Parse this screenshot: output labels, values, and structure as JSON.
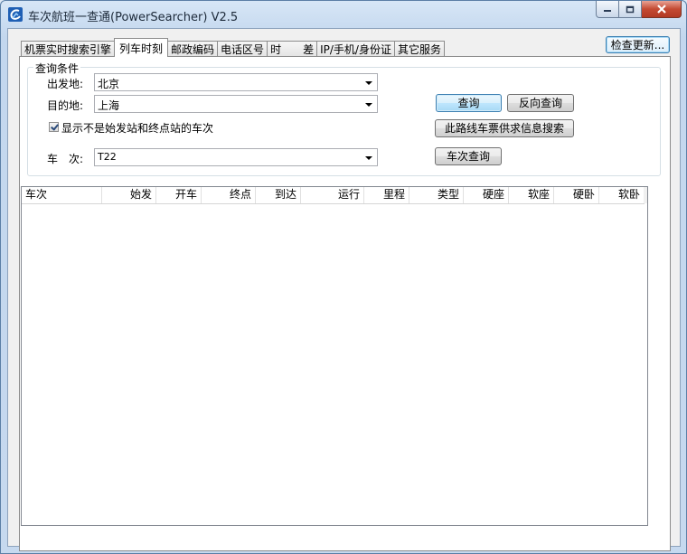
{
  "window": {
    "title": "车次航班一查通(PowerSearcher) V2.5"
  },
  "tabs": [
    {
      "label": "机票实时搜索引擎",
      "active": false
    },
    {
      "label": "列车时刻",
      "active": true
    },
    {
      "label": "邮政编码",
      "active": false
    },
    {
      "label": "电话区号",
      "active": false
    },
    {
      "label": "时　　差",
      "active": false
    },
    {
      "label": "IP/手机/身份证",
      "active": false
    },
    {
      "label": "其它服务",
      "active": false
    }
  ],
  "check_update_label": "检查更新...",
  "query": {
    "group_title": "查询条件",
    "departure_label": "出发地:",
    "departure_value": "北京",
    "destination_label": "目的地:",
    "destination_value": "上海",
    "show_nonterminal_label": "显示不是始发站和终点站的车次",
    "show_nonterminal_checked": true,
    "train_label": "车　次:",
    "train_value": "T22",
    "search_button": "查询",
    "reverse_button": "反向查询",
    "ticket_button": "此路线车票供求信息搜索",
    "train_search_button": "车次查询"
  },
  "table": {
    "columns": [
      "车次",
      "始发",
      "开车",
      "终点",
      "到达",
      "运行",
      "里程",
      "类型",
      "硬座",
      "软座",
      "硬卧",
      "软卧"
    ],
    "rows": []
  }
}
